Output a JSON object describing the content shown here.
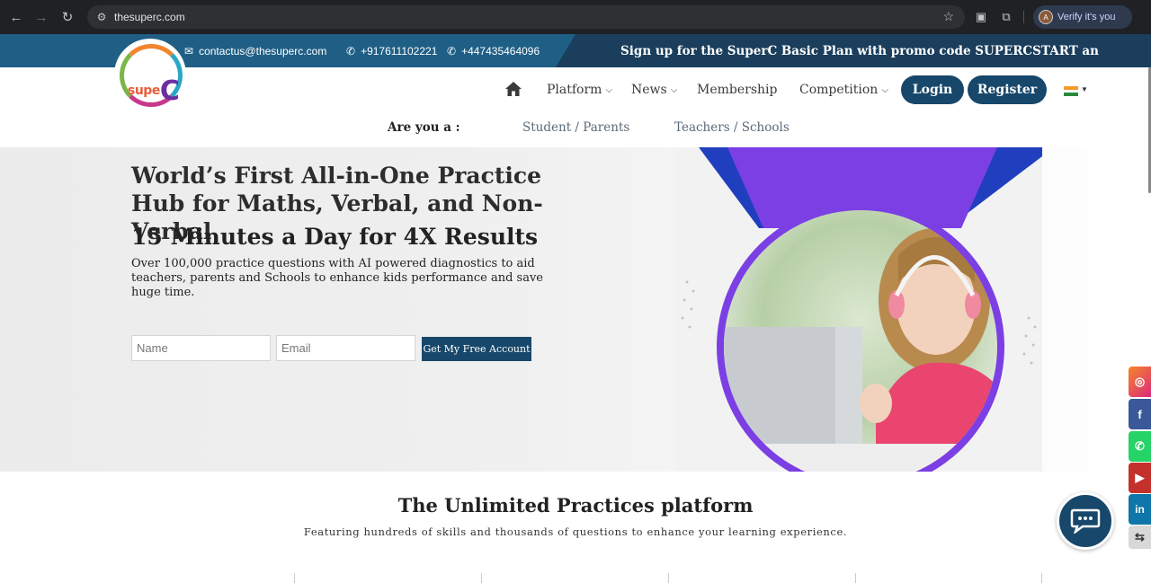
{
  "browser": {
    "url": "thesuperc.com",
    "profile_label": "Verify it's you",
    "profile_initial": "A"
  },
  "topbar": {
    "email": "contactus@thesuperc.com",
    "phone1": "+917611102221",
    "phone2": "+447435464096",
    "promo": "Sign up for the SuperC Basic Plan with promo code SUPERCSTART an"
  },
  "logo": {
    "text_left": "supe",
    "text_c": "C"
  },
  "nav": {
    "platform": "Platform",
    "news": "News",
    "membership": "Membership",
    "competition": "Competition",
    "login": "Login",
    "register": "Register"
  },
  "audience": {
    "label": "Are you a :",
    "student": "Student / Parents",
    "teachers": "Teachers / Schools"
  },
  "hero": {
    "headline": "World’s First All-in-One Practice Hub for Maths, Verbal, and Non-Verbal",
    "subheadline": "15 Minutes a Day for 4X Results",
    "lead": "Over 100,000 practice questions with AI powered diagnostics to aid teachers, parents and Schools to enhance kids performance and save huge time.",
    "name_placeholder": "Name",
    "email_placeholder": "Email",
    "cta": "Get My Free Account"
  },
  "section": {
    "title": "The Unlimited Practices platform",
    "subtitle": "Featuring hundreds of skills and thousands of questions to enhance your learning experience."
  },
  "social": {
    "instagram_color": "#e1306c",
    "facebook_color": "#3b5998",
    "whatsapp_color": "#25d366",
    "youtube_color": "#c4302b",
    "linkedin_color": "#0e76a8"
  },
  "colors": {
    "brand": "#17476a",
    "topbar": "#1a3e5c",
    "accent_purple": "#7b3fe4"
  }
}
